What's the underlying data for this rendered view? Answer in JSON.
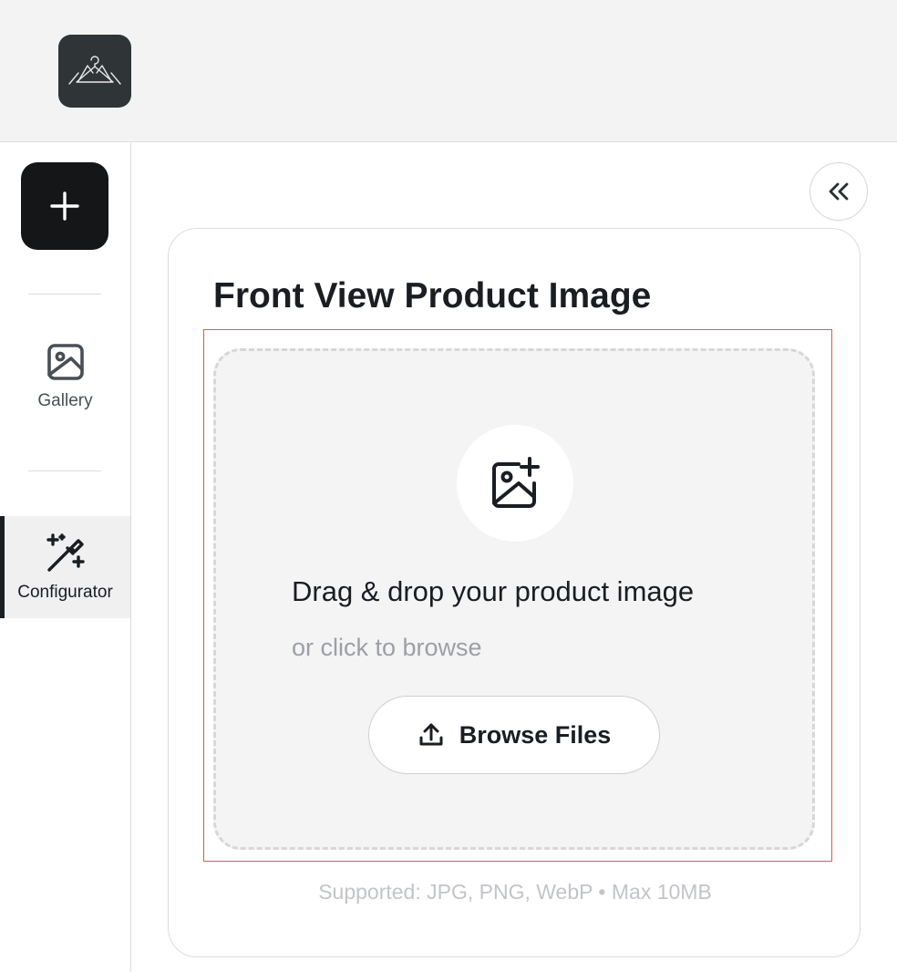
{
  "sidebar": {
    "items": [
      {
        "label": "Gallery",
        "icon": "image-icon"
      },
      {
        "label": "Configurator",
        "icon": "magic-wand-icon",
        "active": true
      }
    ]
  },
  "card": {
    "title": "Front View Product Image"
  },
  "dropzone": {
    "title": "Drag & drop your product image",
    "subtitle": "or click to browse",
    "browse_label": "Browse Files",
    "supported": "Supported: JPG, PNG, WebP • Max 10MB"
  },
  "colors": {
    "accent_dark": "#141617",
    "logo_bg": "#2f3436",
    "highlight_border": "#e35a3c",
    "dropzone_bg": "#f4f4f5"
  }
}
